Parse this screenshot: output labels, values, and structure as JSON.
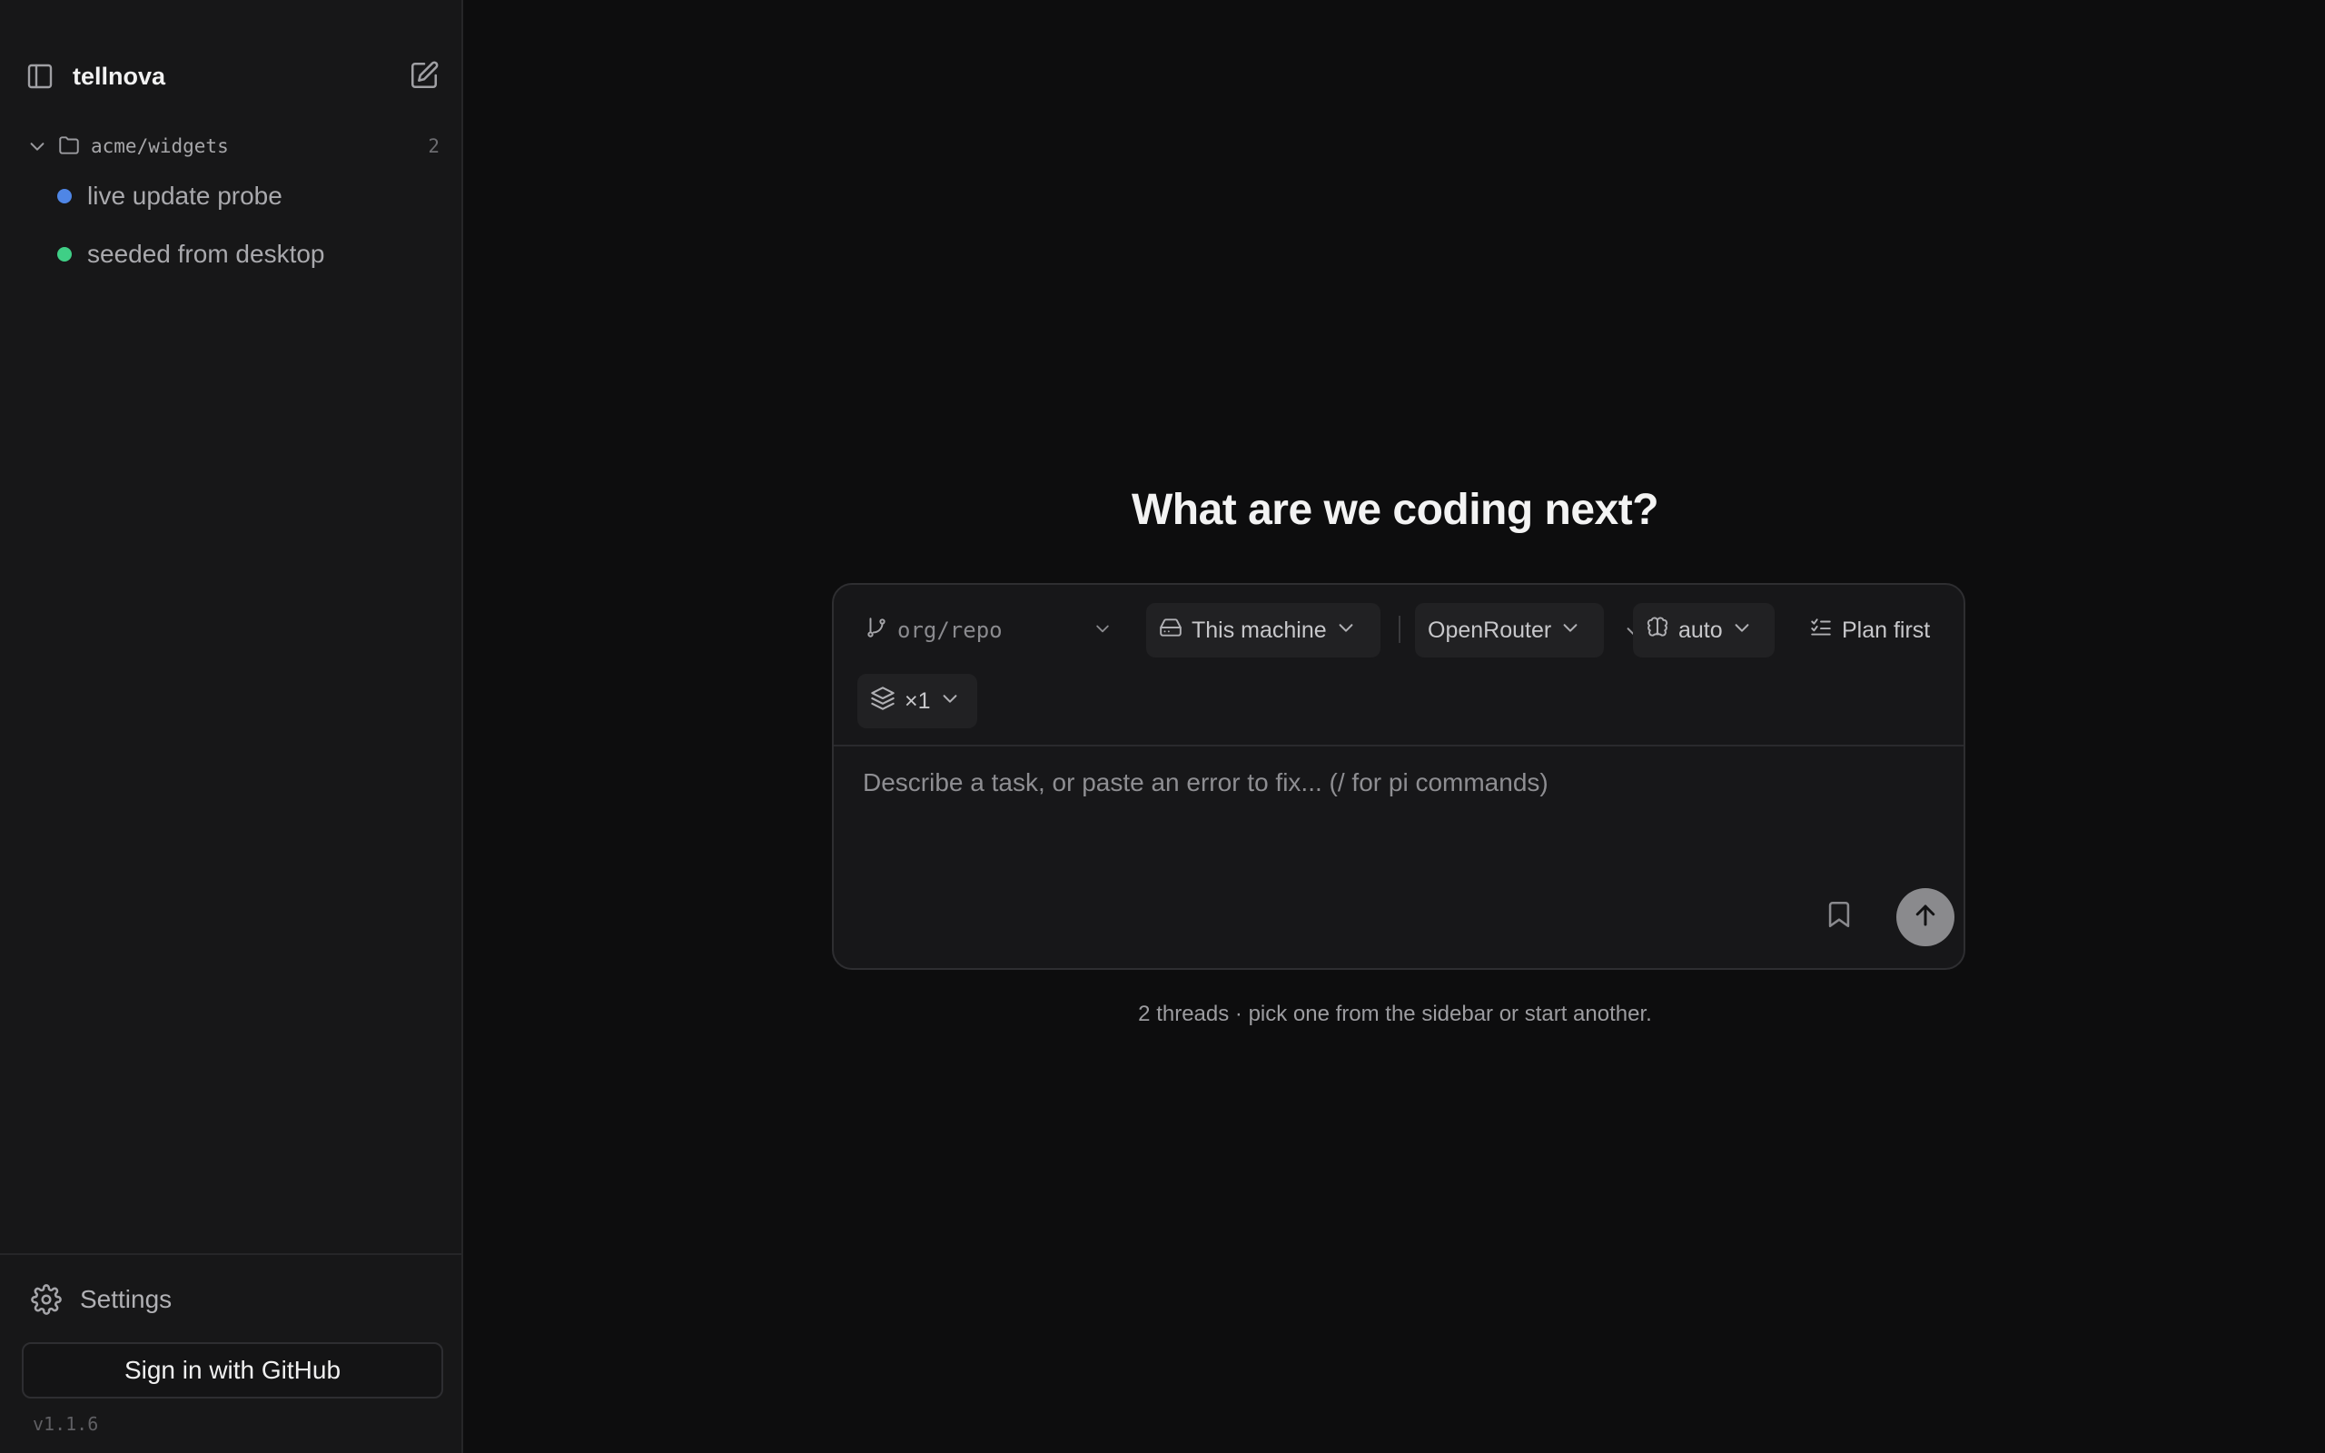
{
  "app": {
    "title": "tellnova",
    "version": "v1.1.6"
  },
  "sidebar": {
    "project": {
      "name": "acme/widgets",
      "count": "2"
    },
    "threads": [
      {
        "label": "live update probe",
        "status_color": "#4f86e6"
      },
      {
        "label": "seeded from desktop",
        "status_color": "#3fcf86"
      }
    ],
    "settings_label": "Settings",
    "signin_label": "Sign in with GitHub"
  },
  "main": {
    "headline": "What are we coding next?",
    "composer": {
      "repo_placeholder": "org/repo",
      "machine_label": "This machine",
      "provider_label": "OpenRouter",
      "model_label": "auto",
      "plan_label": "Plan first",
      "count_label": "×1",
      "prompt_placeholder": "Describe a task, or paste an error to fix... (/ for pi commands)"
    },
    "hint": "2 threads · pick one from the sidebar or start another."
  },
  "icons": {
    "sidebar_toggle": "sidebar-toggle-icon",
    "new_thread": "compose-icon",
    "chevron": "chevron-down-icon",
    "folder": "folder-icon",
    "gear": "gear-icon",
    "branch": "git-branch-icon",
    "drive": "hard-drive-icon",
    "brain": "brain-icon",
    "list_check": "list-check-icon",
    "layers": "layers-icon",
    "bookmark": "bookmark-icon",
    "arrow_up": "arrow-up-icon"
  },
  "colors": {
    "background": "#0d0d0e",
    "sidebar": "#171718",
    "composer": "#171719",
    "send_button": "#8a8a8d"
  }
}
